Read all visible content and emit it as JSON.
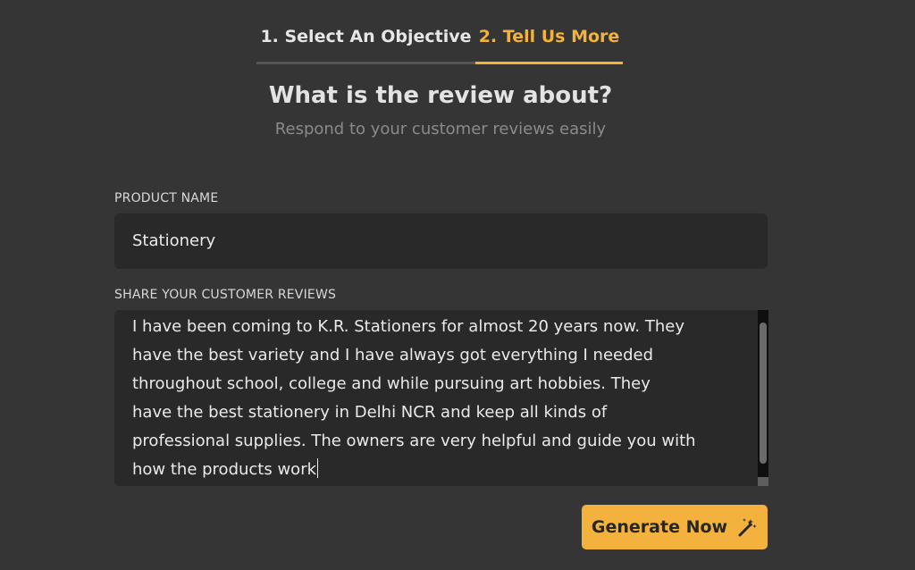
{
  "tabs": [
    {
      "label": "1. Select An Objective",
      "active": false
    },
    {
      "label": "2. Tell Us More",
      "active": true
    }
  ],
  "header": {
    "title": "What is the review about?",
    "subtitle": "Respond to your customer reviews easily"
  },
  "form": {
    "product_name": {
      "label": "PRODUCT NAME",
      "value": "Stationery"
    },
    "reviews": {
      "label": "SHARE YOUR CUSTOMER REVIEWS",
      "lines": [
        "I have been coming to K.R. Stationers for almost 20 years now. They",
        "have the best variety and I have always got everything I needed",
        "throughout school, college and while pursuing art hobbies. They",
        "have the best stationery in Delhi NCR and keep all kinds of",
        "professional supplies. The owners are very helpful and guide you with",
        "how the products work"
      ]
    }
  },
  "actions": {
    "generate_label": "Generate Now",
    "generate_icon": "magic-wand-icon"
  },
  "colors": {
    "background": "#353535",
    "accent": "#f3b23d",
    "field": "#292929"
  }
}
